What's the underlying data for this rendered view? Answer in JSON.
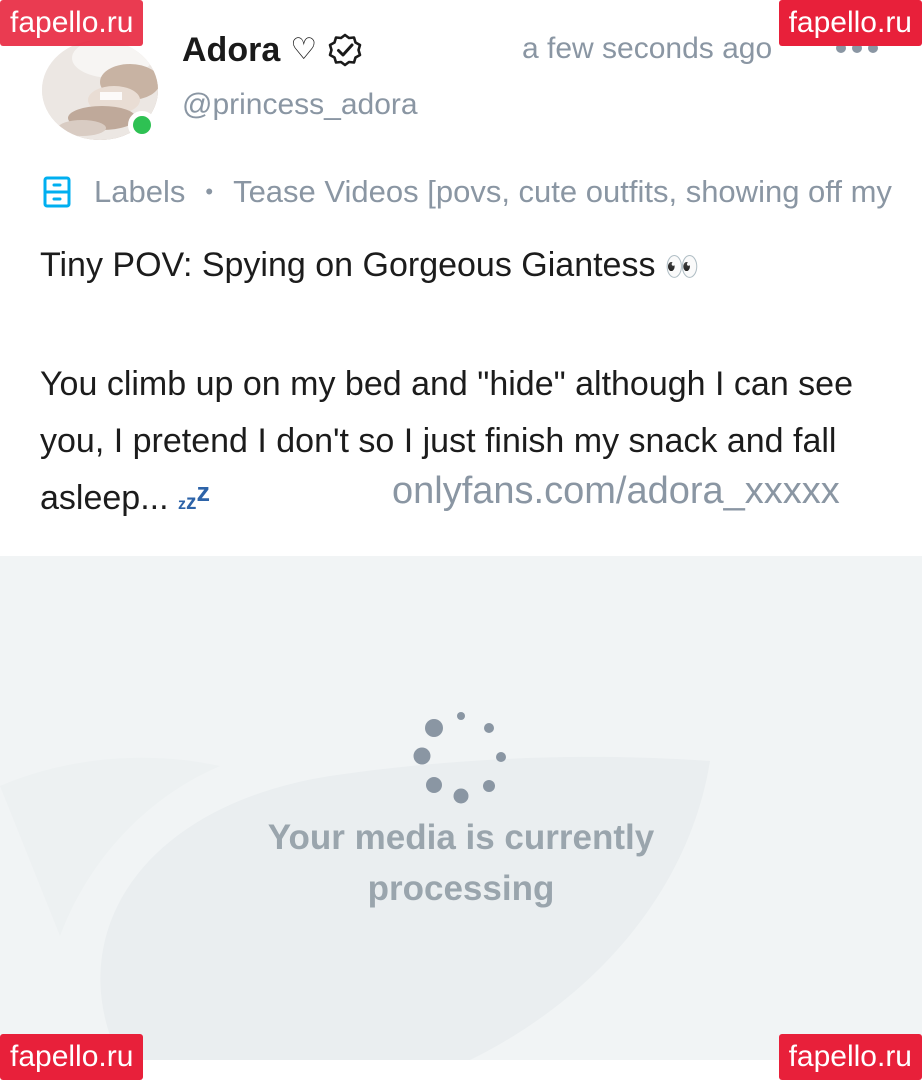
{
  "post": {
    "author_name": "Adora",
    "author_handle": "@princess_adora",
    "heart_symbol": "♡",
    "timestamp": "a few seconds ago",
    "labels_title": "Labels",
    "labels_separator": "•",
    "label_value": "Tease Videos [povs, cute outfits, showing off my",
    "title": "Tiny POV: Spying on Gorgeous Giantess",
    "title_emoji": "👀",
    "body": "You climb up on my bed and \"hide\" although I can see you, I pretend I don't so I just finish my snack and fall asleep...",
    "body_emoji": "zzz"
  },
  "media": {
    "status_line1": "Your media is currently",
    "status_line2": "processing",
    "source_url": "onlyfans.com/adora_xxxxx"
  },
  "watermarks": {
    "top_left": "fapello.ru",
    "top_right": "fapello.ru",
    "bottom_left": "fapello.ru",
    "bottom_right": "fapello.ru"
  },
  "icons": {
    "verified": "verified-badge-icon",
    "more": "more-options-icon",
    "labels": "label-bookmark-icon",
    "spinner": "loading-spinner-icon",
    "online": "online-status-icon"
  },
  "colors": {
    "muted_text": "#8a96a3",
    "online_green": "#2ec153",
    "label_icon_blue": "#00aff0",
    "badge_red": "#e8203a",
    "media_bg": "#f1f4f5"
  }
}
